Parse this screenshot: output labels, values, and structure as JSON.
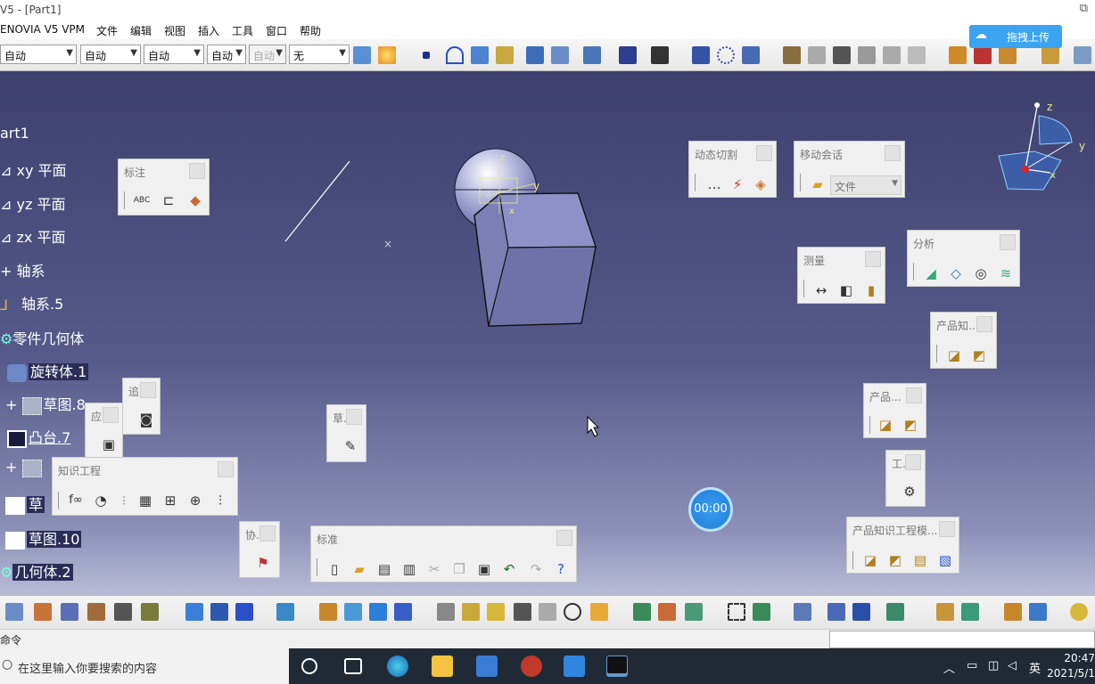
{
  "window": {
    "title": "V5 - [Part1]",
    "restore_glyph": "⧉"
  },
  "menu": [
    "ENOVIA V5 VPM",
    "文件",
    "编辑",
    "视图",
    "插入",
    "工具",
    "窗口",
    "帮助"
  ],
  "upload_button": {
    "label": "拖拽上传",
    "icon": "cloud-icon"
  },
  "toolbar_combos": [
    {
      "value": "自动"
    },
    {
      "value": "自动"
    },
    {
      "value": "自动"
    },
    {
      "value": "自动"
    },
    {
      "value": "自动"
    },
    {
      "value": "无"
    }
  ],
  "tree": {
    "root": "art1",
    "items": [
      {
        "label": "xy 平面"
      },
      {
        "label": "yz 平面"
      },
      {
        "label": "zx 平面"
      },
      {
        "label": "轴系"
      },
      {
        "label": "轴系.5"
      },
      {
        "label": "零件几何体"
      },
      {
        "label": "旋转体.1"
      },
      {
        "label": "草图.8"
      },
      {
        "label": "凸台.7"
      },
      {
        "label": "草"
      },
      {
        "label": "草图.10"
      },
      {
        "label": "几何体.2"
      }
    ]
  },
  "floating_toolbars": {
    "annotation": {
      "title": "标注"
    },
    "track": {
      "title": "追."
    },
    "apply": {
      "title": "应."
    },
    "knowledge": {
      "title": "知识工程"
    },
    "sketch": {
      "title": "草."
    },
    "collab": {
      "title": "协."
    },
    "standard": {
      "title": "标准"
    },
    "dynamic_section": {
      "title": "动态切割"
    },
    "mobile_session": {
      "title": "移动会话",
      "combo": "文件"
    },
    "measure": {
      "title": "测量"
    },
    "analysis": {
      "title": "分析"
    },
    "product_knowledge": {
      "title": "产品知..."
    },
    "product": {
      "title": "产品..."
    },
    "tools": {
      "title": "工."
    },
    "product_template": {
      "title": "产品知识工程模..."
    }
  },
  "compass": {
    "z": "z",
    "y": "y",
    "x": "x"
  },
  "part_axis_labels": {
    "z": "z",
    "y": "y",
    "x": "x"
  },
  "timer": "00:00",
  "statusbar": {
    "prompt": "命令"
  },
  "taskbar": {
    "search_placeholder": "在这里输入你要搜索的内容",
    "ime": "英",
    "time": "20:47",
    "date": "2021/5/1"
  },
  "colors": {
    "viewport_top": "#3e3f6e",
    "viewport_bottom": "#b9bcd6",
    "accent": "#3aa3f2"
  }
}
